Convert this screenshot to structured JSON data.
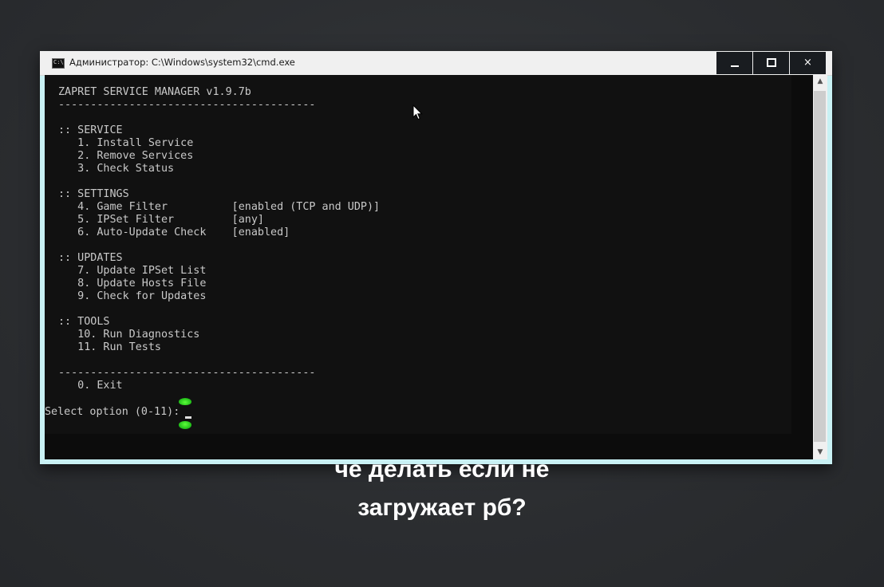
{
  "window": {
    "title": "Администратор: C:\\Windows\\system32\\cmd.exe",
    "icon_text": "C:\\",
    "buttons": {
      "minimize": "minimize-icon",
      "maximize": "maximize-icon",
      "close": "×"
    }
  },
  "console": {
    "text": "ZAPRET SERVICE MANAGER v1.9.7b\n----------------------------------------\n\n:: SERVICE\n   1. Install Service\n   2. Remove Services\n   3. Check Status\n\n:: SETTINGS\n   4. Game Filter          [enabled (TCP and UDP)]\n   5. IPSet Filter         [any]\n   6. Auto-Update Check    [enabled]\n\n:: UPDATES\n   7. Update IPSet List\n   8. Update Hosts File\n   9. Check for Updates\n\n:: TOOLS\n   10. Run Diagnostics\n   11. Run Tests\n\n----------------------------------------\n   0. Exit",
    "prompt": "Select option (0-11): "
  },
  "scrollbar": {
    "up_arrow": "▲",
    "down_arrow": "▼"
  },
  "subtitles": {
    "line1": "че делать если не",
    "line2": "загружает рб?"
  },
  "colors": {
    "console_bg": "#0c0c0c",
    "console_text": "#c9c9c9",
    "window_border": "#c9f1f4",
    "caption_button_bg": "#191c20",
    "indicator_green": "#1fbb18"
  }
}
